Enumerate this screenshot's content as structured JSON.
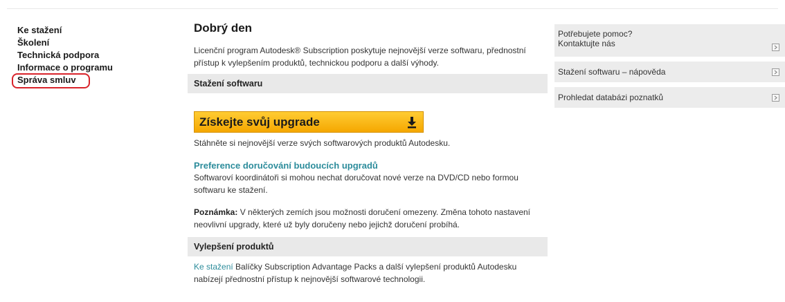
{
  "left_nav": {
    "items": [
      {
        "label": "Ke stažení"
      },
      {
        "label": "Školení"
      },
      {
        "label": "Technická podpora"
      },
      {
        "label": "Informace o programu"
      },
      {
        "label": "Správa smluv",
        "highlighted": true
      }
    ],
    "highlight_color": "#d8232a"
  },
  "main": {
    "title": "Dobrý den",
    "intro": "Licenční program Autodesk® Subscription poskytuje nejnovější verze softwaru, přednostní přístup k vylepšením produktů, technickou podporu a další výhody.",
    "section_download": "Stažení softwaru",
    "upgrade_button": {
      "label": "Získejte svůj upgrade",
      "icon": "download-icon",
      "color": "#f5a700"
    },
    "download_text": "Stáhněte si nejnovější verze svých softwarových produktů Autodesku.",
    "preferences_link": "Preference doručování budoucích upgradů",
    "preferences_text": "Softwaroví koordinátoři si mohou nechat doručovat nové verze na DVD/CD nebo formou softwaru ke stažení.",
    "note_label": "Poznámka:",
    "note_text": " V některých zemích jsou možnosti doručení omezeny. Změna tohoto nastavení neovlivní upgrady, které už byly doručeny nebo jejichž doručení probíhá.",
    "section_enhancements": "Vylepšení produktů",
    "enh_link": "Ke stažení",
    "enh_text": " Balíčky Subscription Advantage Packs a další vylepšení produktů Autodesku nabízejí přednostní přístup k nejnovější softwarové technologii.",
    "link_color": "#2c8c9b"
  },
  "right_panel": {
    "help_line1": "Potřebujete pomoc?",
    "help_line2": "Kontaktujte nás",
    "download_help": "Stažení softwaru – nápověda",
    "knowledge_base": "Prohledat databázi poznatků",
    "arrow_icon": "arrow-right-icon"
  }
}
